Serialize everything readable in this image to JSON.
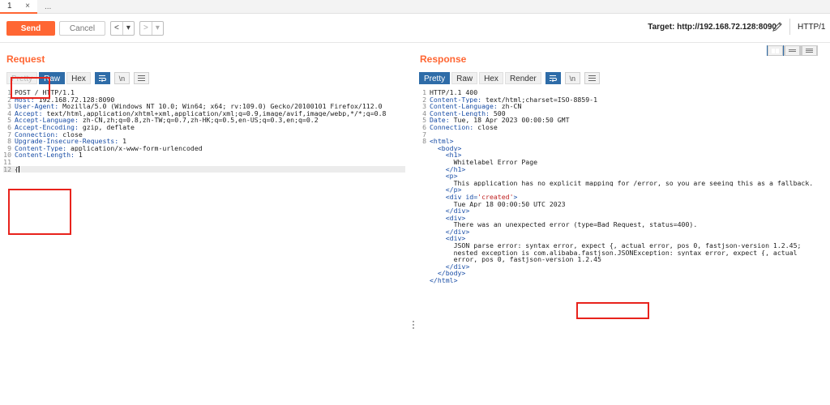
{
  "tabs": [
    {
      "label": "1",
      "close": "×"
    },
    {
      "label": "..."
    }
  ],
  "toolbar": {
    "send_label": "Send",
    "cancel_label": "Cancel",
    "back_label": "<",
    "back_dropdown": "▾",
    "forward_label": ">",
    "forward_dropdown": "▾",
    "target": "Target: http://192.168.72.128:8090",
    "http_version": "HTTP/1"
  },
  "request": {
    "title": "Request",
    "view_tabs": [
      "Pretty",
      "Raw",
      "Hex"
    ],
    "selected_view": "Raw",
    "newline_label": "\\n",
    "lines": [
      {
        "n": "1",
        "key": "",
        "value": "POST / HTTP/1.1"
      },
      {
        "n": "2",
        "key": "Host",
        "value": " 192.168.72.128:8090"
      },
      {
        "n": "3",
        "key": "User-Agent",
        "value": " Mozilla/5.0 (Windows NT 10.0; Win64; x64; rv:109.0) Gecko/20100101 Firefox/112.0"
      },
      {
        "n": "4",
        "key": "Accept",
        "value": " text/html,application/xhtml+xml,application/xml;q=0.9,image/avif,image/webp,*/*;q=0.8"
      },
      {
        "n": "5",
        "key": "Accept-Language",
        "value": " zh-CN,zh;q=0.8,zh-TW;q=0.7,zh-HK;q=0.5,en-US;q=0.3,en;q=0.2"
      },
      {
        "n": "6",
        "key": "Accept-Encoding",
        "value": " gzip, deflate"
      },
      {
        "n": "7",
        "key": "Connection",
        "value": " close"
      },
      {
        "n": "8",
        "key": "Upgrade-Insecure-Requests",
        "value": " 1"
      },
      {
        "n": "9",
        "key": "Content-Type",
        "value": " application/x-www-form-urlencoded"
      },
      {
        "n": "10",
        "key": "Content-Length",
        "value": " 1"
      },
      {
        "n": "11",
        "key": "",
        "value": ""
      },
      {
        "n": "12",
        "key": "",
        "value": "{"
      }
    ]
  },
  "response": {
    "title": "Response",
    "view_tabs": [
      "Pretty",
      "Raw",
      "Hex",
      "Render"
    ],
    "selected_view": "Pretty",
    "newline_label": "\\n",
    "headers": [
      {
        "n": "1",
        "key": "",
        "value": "HTTP/1.1 400"
      },
      {
        "n": "2",
        "key": "Content-Type",
        "value": " text/html;charset=ISO-8859-1"
      },
      {
        "n": "3",
        "key": "Content-Language",
        "value": " zh-CN"
      },
      {
        "n": "4",
        "key": "Content-Length",
        "value": " 500"
      },
      {
        "n": "5",
        "key": "Date",
        "value": " Tue, 18 Apr 2023 00:00:50 GMT"
      },
      {
        "n": "6",
        "key": "Connection",
        "value": " close"
      },
      {
        "n": "7",
        "key": "",
        "value": ""
      }
    ],
    "body": [
      {
        "n": "8",
        "indent": 0,
        "kind": "tag",
        "text": "<html>"
      },
      {
        "n": "",
        "indent": 1,
        "kind": "tag",
        "text": "<body>"
      },
      {
        "n": "",
        "indent": 2,
        "kind": "tag",
        "text": "<h1>"
      },
      {
        "n": "",
        "indent": 3,
        "kind": "text",
        "text": "Whitelabel Error Page"
      },
      {
        "n": "",
        "indent": 2,
        "kind": "tag",
        "text": "</h1>"
      },
      {
        "n": "",
        "indent": 2,
        "kind": "tag",
        "text": "<p>"
      },
      {
        "n": "",
        "indent": 3,
        "kind": "text",
        "text": "This application has no explicit mapping for /error, so you are seeing this as a fallback."
      },
      {
        "n": "",
        "indent": 2,
        "kind": "tag",
        "text": "</p>"
      },
      {
        "n": "",
        "indent": 2,
        "kind": "tagattr",
        "text": "<div id=",
        "str": "'created'",
        "close": ">"
      },
      {
        "n": "",
        "indent": 3,
        "kind": "text",
        "text": "Tue Apr 18 00:00:50 UTC 2023"
      },
      {
        "n": "",
        "indent": 2,
        "kind": "tag",
        "text": "</div>"
      },
      {
        "n": "",
        "indent": 2,
        "kind": "tag",
        "text": "<div>"
      },
      {
        "n": "",
        "indent": 3,
        "kind": "text",
        "text": "There was an unexpected error (type=Bad Request, status=400)."
      },
      {
        "n": "",
        "indent": 2,
        "kind": "tag",
        "text": "</div>"
      },
      {
        "n": "",
        "indent": 2,
        "kind": "tag",
        "text": "<div>"
      },
      {
        "n": "",
        "indent": 3,
        "kind": "text",
        "text": "JSON parse error: syntax error, expect {, actual error, pos 0, fastjson-version 1.2.45;"
      },
      {
        "n": "",
        "indent": 3,
        "kind": "text",
        "text": "nested exception is com.alibaba.fastjson.JSONException: syntax error, expect {, actual"
      },
      {
        "n": "",
        "indent": 3,
        "kind": "text",
        "text": "error, pos 0, fastjson-version 1.2.45"
      },
      {
        "n": "",
        "indent": 2,
        "kind": "tag",
        "text": "</div>"
      },
      {
        "n": "",
        "indent": 1,
        "kind": "tag",
        "text": "</body>"
      },
      {
        "n": "",
        "indent": 0,
        "kind": "tag",
        "text": "</html>"
      }
    ]
  }
}
